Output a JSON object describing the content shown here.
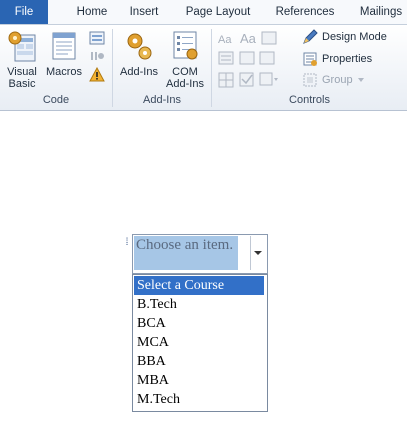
{
  "tabs": [
    "File",
    "Home",
    "Insert",
    "Page Layout",
    "References",
    "Mailings"
  ],
  "groups": {
    "code": {
      "label": "Code",
      "visual_basic": "Visual\nBasic",
      "visual_basic_line1": "Visual",
      "visual_basic_line2": "Basic",
      "macros": "Macros"
    },
    "addins": {
      "label": "Add-Ins",
      "addins": "Add-Ins",
      "com_line1": "COM",
      "com_line2": "Add-Ins"
    },
    "controls": {
      "label": "Controls",
      "design_mode": "Design Mode",
      "properties": "Properties",
      "group": "Group"
    }
  },
  "content_control": {
    "placeholder": "Choose an item."
  },
  "dropdown": {
    "options": [
      "Select a Course",
      "B.Tech",
      "BCA",
      "MCA",
      "BBA",
      "MBA",
      "M.Tech"
    ],
    "selected_index": 0
  }
}
